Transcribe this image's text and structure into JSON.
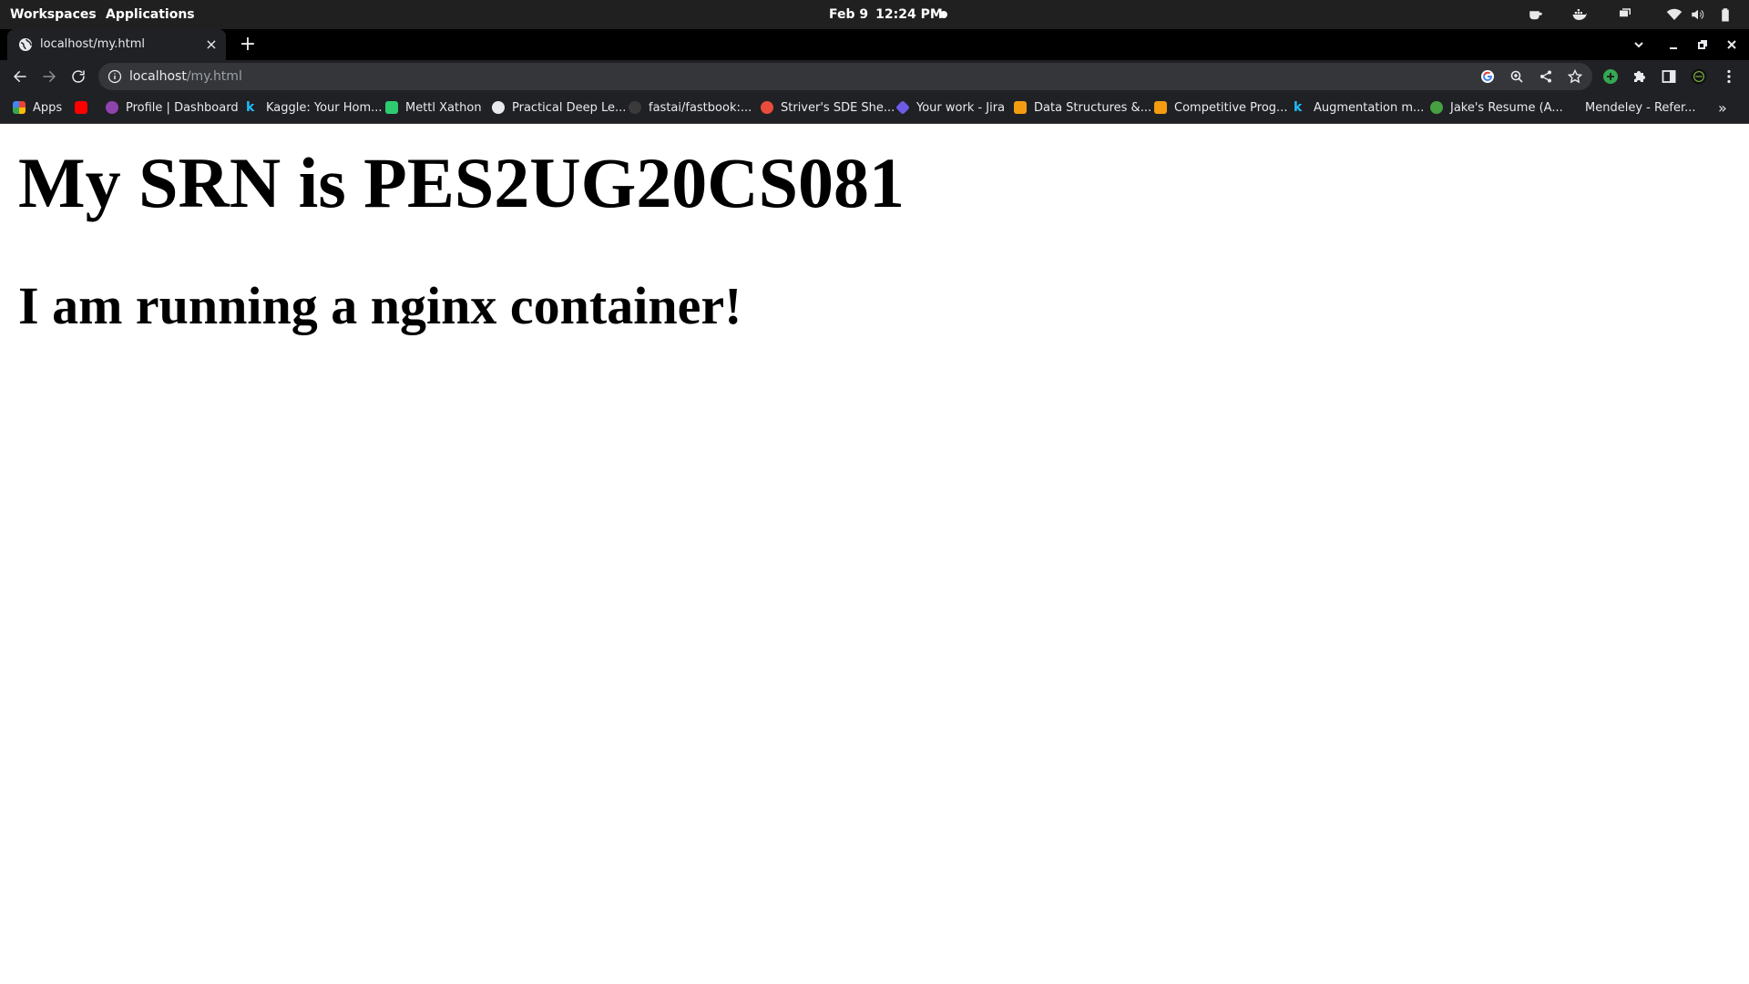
{
  "topbar": {
    "workspaces": "Workspaces",
    "applications": "Applications",
    "date": "Feb 9",
    "time": "12:24 PM",
    "tray_icons": [
      "coffee-icon",
      "docker-icon",
      "screens-icon",
      "wifi-icon",
      "volume-icon",
      "battery-icon"
    ]
  },
  "tab": {
    "title": "localhost/my.html",
    "close_glyph": "×",
    "new_tab_glyph": "+"
  },
  "omnibox": {
    "host": "localhost",
    "path": "/my.html"
  },
  "bookmarks": [
    {
      "label": "Apps",
      "icon": "apps-grid-icon",
      "color": "#ea4335"
    },
    {
      "label": "",
      "icon": "youtube-icon",
      "color": "#ff0000"
    },
    {
      "label": "Profile | Dashboard",
      "icon": "profile-icon",
      "color": "#8e44ad"
    },
    {
      "label": "Kaggle: Your Hom...",
      "icon": "kaggle-icon",
      "color": "#20beff"
    },
    {
      "label": "Mettl Xathon",
      "icon": "mettl-icon",
      "color": "#2ecc71"
    },
    {
      "label": "Practical Deep Le...",
      "icon": "globe-icon",
      "color": "#e8eaed"
    },
    {
      "label": "fastai/fastbook:...",
      "icon": "github-icon",
      "color": "#555555"
    },
    {
      "label": "Striver's SDE She...",
      "icon": "tuf-icon",
      "color": "#e74c3c"
    },
    {
      "label": "Your work - Jira",
      "icon": "jira-icon",
      "color": "#6c5ce7"
    },
    {
      "label": "Data Structures &...",
      "icon": "codechef-icon",
      "color": "#f39c12"
    },
    {
      "label": "Competitive Prog...",
      "icon": "codechef-icon",
      "color": "#f39c12"
    },
    {
      "label": "Augmentation m...",
      "icon": "kaggle-icon",
      "color": "#20beff"
    },
    {
      "label": "Jake's Resume (A...",
      "icon": "overleaf-icon",
      "color": "#47a141"
    },
    {
      "label": "Mendeley - Refer...",
      "icon": "mendeley-icon",
      "color": "#202124"
    }
  ],
  "bookmarks_more": "»",
  "page": {
    "heading1": "My SRN is PES2UG20CS081",
    "heading2": "I am running a nginx container!"
  },
  "colors": {
    "topbar_bg": "#202020",
    "tabstrip_bg": "#000000",
    "toolbar_bg": "#202124",
    "omnibox_bg": "#35363a",
    "extension_green": "#34a853"
  }
}
